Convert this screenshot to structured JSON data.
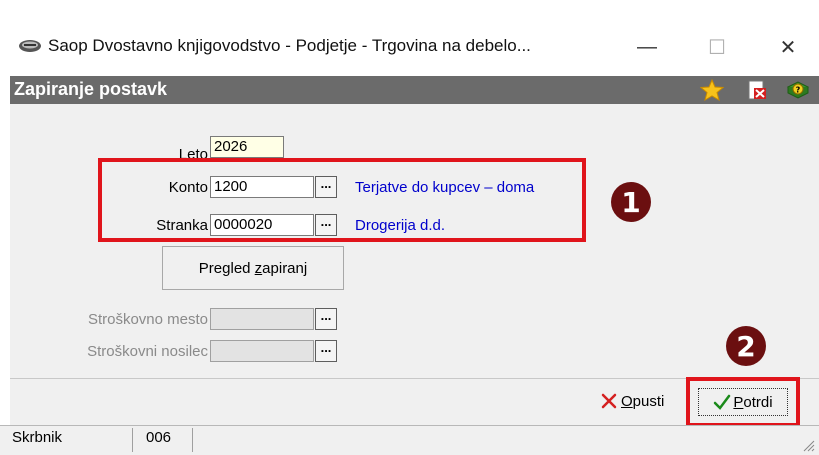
{
  "window": {
    "title": "Saop Dvostavno knjigovodstvo - Podjetje - Trgovina na debelo...",
    "minimize": "—",
    "maximize": "☐",
    "close": "✕"
  },
  "header": {
    "title": "Zapiranje postavk",
    "icons": [
      "star-icon",
      "document-delete-icon",
      "book-help-icon"
    ]
  },
  "form": {
    "leto": {
      "label": "Leto",
      "value": "2026"
    },
    "konto": {
      "label": "Konto",
      "value": "1200",
      "picker": "...",
      "description": "Terjatve do kupcev – doma"
    },
    "stranka": {
      "label": "Stranka",
      "value": "0000020",
      "picker": "...",
      "description": "Drogerija d.d."
    },
    "pregled_button": {
      "prefix": "Pregled ",
      "underlined": "z",
      "suffix": "apiranj"
    },
    "stroskovno_mesto": {
      "label": "Stroškovno mesto",
      "value": "",
      "picker": "..."
    },
    "stroskovni_nosilec": {
      "label": "Stroškovni nosilec",
      "value": "",
      "picker": "..."
    }
  },
  "markers": {
    "one": "1",
    "two": "2"
  },
  "actions": {
    "cancel": {
      "underlined": "O",
      "rest": "pusti"
    },
    "confirm": {
      "underlined": "P",
      "rest": "otrdi"
    }
  },
  "status": {
    "user": "Skrbnik",
    "code": "006"
  },
  "colors": {
    "highlight_red": "#e0141b",
    "link_blue": "#0000cc",
    "marker": "#6b0f10",
    "header_bg": "#6b6b6b"
  }
}
